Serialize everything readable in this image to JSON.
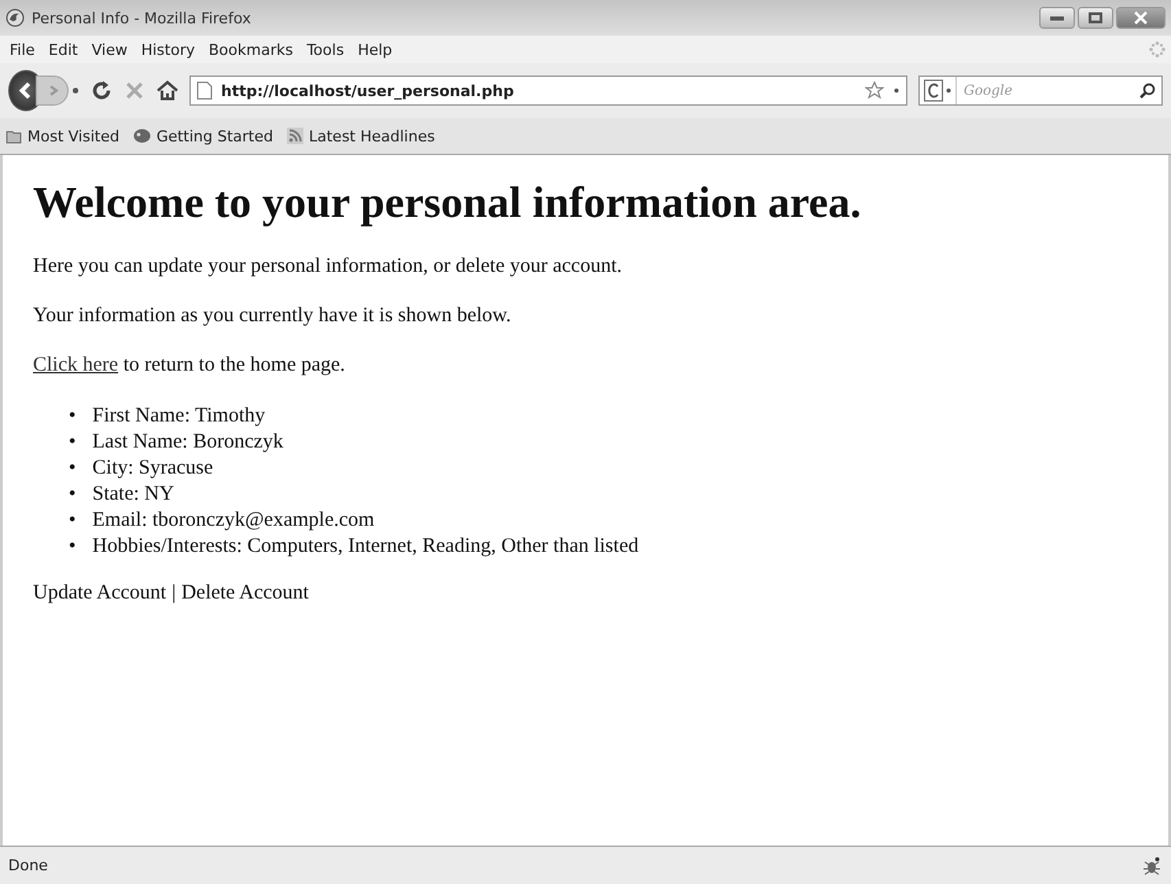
{
  "window": {
    "title": "Personal Info - Mozilla Firefox"
  },
  "menu": [
    {
      "label": "File"
    },
    {
      "label": "Edit"
    },
    {
      "label": "View"
    },
    {
      "label": "History"
    },
    {
      "label": "Bookmarks"
    },
    {
      "label": "Tools"
    },
    {
      "label": "Help"
    }
  ],
  "address_bar": {
    "value": "http://localhost/user_personal.php"
  },
  "search_field": {
    "placeholder": "Google"
  },
  "bookmarks": [
    {
      "label": "Most Visited",
      "kind": "folder"
    },
    {
      "label": "Getting Started",
      "kind": "page"
    },
    {
      "label": "Latest Headlines",
      "kind": "feed"
    }
  ],
  "page": {
    "heading": "Welcome to your personal information area.",
    "paragraphs": [
      "Here you can update your personal information, or delete your account.",
      "Your information as you currently have it is shown below."
    ],
    "return_line": {
      "link": "Click here",
      "text": "to return to the home page."
    },
    "bullet": "•",
    "details": [
      "First Name: Timothy",
      "Last Name: Boronczyk",
      "City: Syracuse",
      "State: NY",
      "Email: tboronczyk@example.com",
      "Hobbies/Interests: Computers, Internet, Reading, Other than listed"
    ],
    "actions": [
      {
        "label": "Update Account"
      },
      {
        "label": "Delete Account"
      }
    ],
    "separator": "|"
  },
  "status_bar": {
    "text": "Done"
  }
}
